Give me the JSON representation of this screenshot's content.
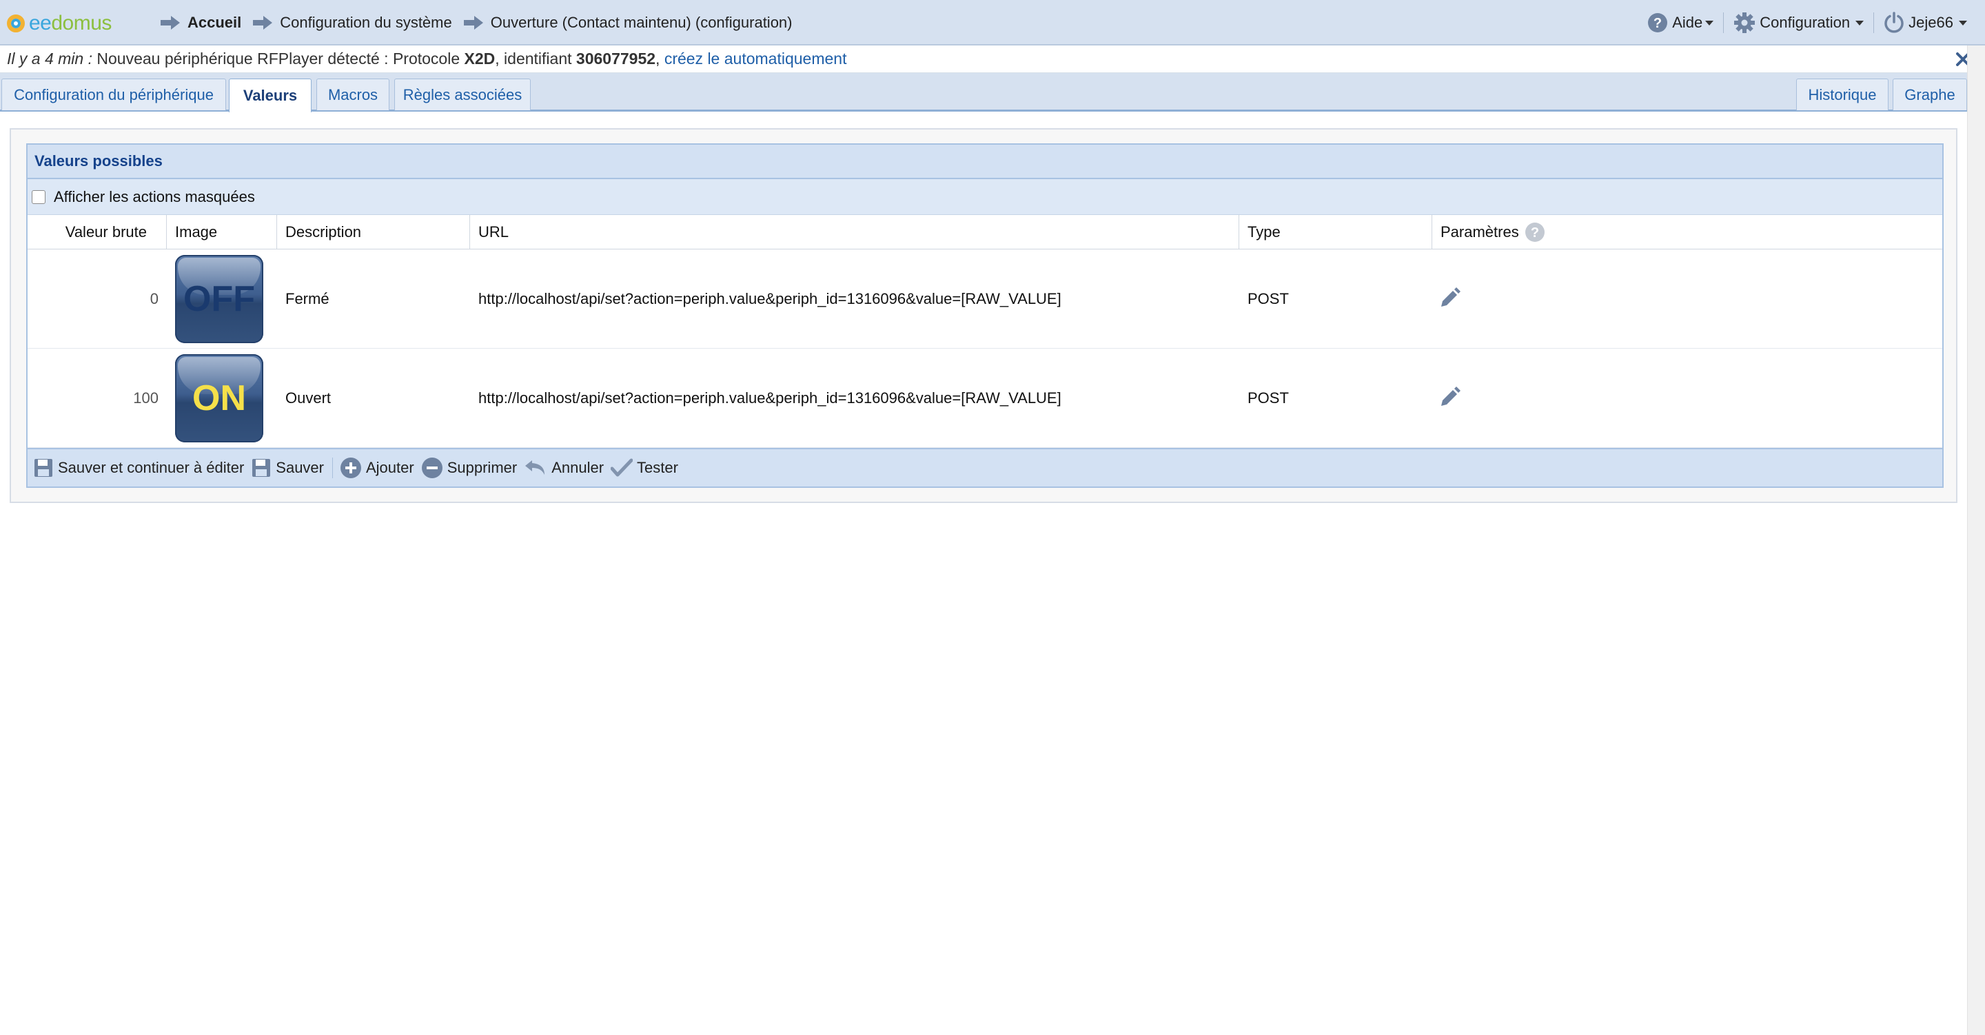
{
  "header": {
    "logo_ee": "ee",
    "logo_domus": "domus",
    "breadcrumbs": [
      {
        "label": "Accueil"
      },
      {
        "label": "Configuration du système"
      },
      {
        "label": "Ouverture (Contact maintenu) (configuration)"
      }
    ],
    "menus": {
      "help": "Aide",
      "config": "Configuration",
      "user": "Jeje66"
    }
  },
  "notification": {
    "time": "Il y a 4 min :",
    "text1": " Nouveau périphérique RFPlayer détecté : Protocole ",
    "protocol": "X2D",
    "text2": ", identifiant ",
    "identifier": "306077952",
    "text3": ", ",
    "link": "créez le automatiquement"
  },
  "tabs": {
    "left": [
      "Configuration du périphérique",
      "Valeurs",
      "Macros",
      "Règles associées"
    ],
    "right": [
      "Historique",
      "Graphe"
    ],
    "active": "Valeurs"
  },
  "grid": {
    "title": "Valeurs possibles",
    "filter_label": "Afficher les actions masquées",
    "columns": [
      "Valeur brute",
      "Image",
      "Description",
      "URL",
      "Type",
      "Paramètres"
    ],
    "rows": [
      {
        "raw": "0",
        "image": "OFF",
        "description": "Fermé",
        "url": "http://localhost/api/set?action=periph.value&periph_id=1316096&value=[RAW_VALUE]",
        "type": "POST"
      },
      {
        "raw": "100",
        "image": "ON",
        "description": "Ouvert",
        "url": "http://localhost/api/set?action=periph.value&periph_id=1316096&value=[RAW_VALUE]",
        "type": "POST"
      }
    ],
    "footer": {
      "save_continue": "Sauver et continuer à éditer",
      "save": "Sauver",
      "add": "Ajouter",
      "delete": "Supprimer",
      "cancel": "Annuler",
      "test": "Tester"
    }
  },
  "colors": {
    "bar_bg": "#d6e1f0",
    "link": "#1f5fa8",
    "grid_header": "#d3e1f3",
    "title_text": "#15428b"
  }
}
